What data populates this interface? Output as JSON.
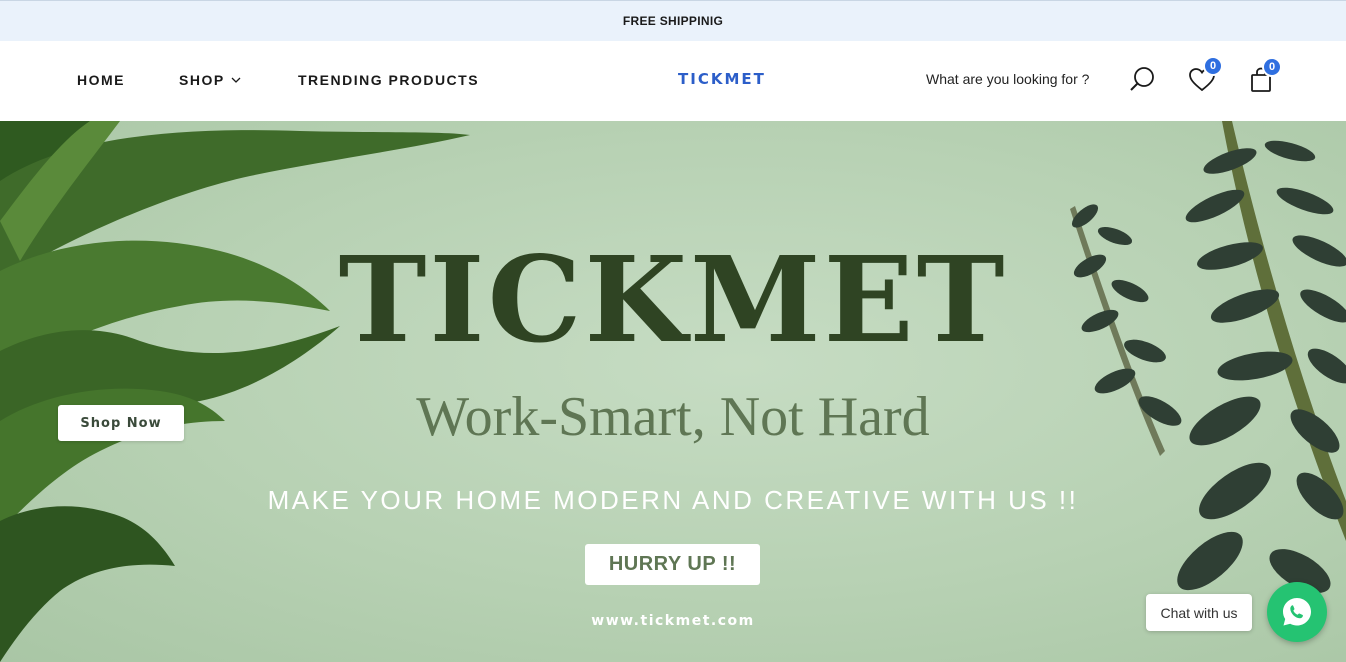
{
  "announcement": {
    "text": "FREE SHIPPINIG"
  },
  "nav": {
    "home": "HOME",
    "shop": "SHOP",
    "trending": "TRENDING PRODUCTS"
  },
  "logo": {
    "text": "TICKMET",
    "color": "#2c5ec9"
  },
  "search": {
    "placeholder": "What are you looking for ?"
  },
  "wishlist": {
    "count": "0",
    "icon": "heart-icon"
  },
  "cart": {
    "count": "0",
    "icon": "shopping-bag-icon"
  },
  "hero": {
    "title": "TICKMET",
    "tagline": "Work-Smart, Not Hard",
    "subtitle": "MAKE YOUR HOME MODERN AND CREATIVE WITH US !!",
    "cta": "HURRY UP !!",
    "url": "www.tickmet.com",
    "shop_now": "Shop Now",
    "background": "#b9d3b5",
    "title_color": "#2f4423"
  },
  "chat": {
    "label": "Chat with us",
    "icon": "whatsapp-icon",
    "color": "#25c372"
  },
  "colors": {
    "badge": "#2f6fe0",
    "announcement_bg": "#eaf2fb"
  }
}
